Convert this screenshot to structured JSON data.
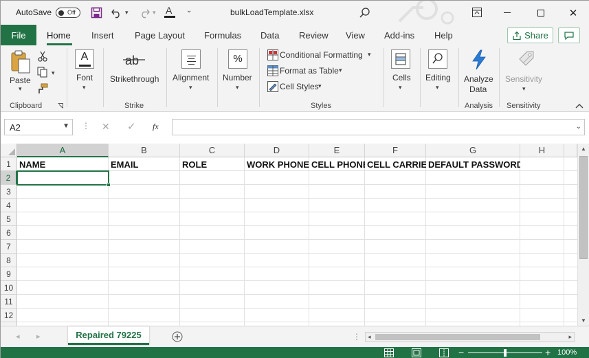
{
  "titlebar": {
    "autosave_label": "AutoSave",
    "autosave_state": "Off",
    "filename": "bulkLoadTemplate.xlsx"
  },
  "menu": {
    "file": "File",
    "tabs": [
      "Home",
      "Insert",
      "Page Layout",
      "Formulas",
      "Data",
      "Review",
      "View",
      "Add-ins",
      "Help"
    ],
    "active_tab": "Home",
    "share": "Share"
  },
  "ribbon": {
    "paste": "Paste",
    "clipboard": "Clipboard",
    "font": "Font",
    "strikethrough": "Strikethrough",
    "strike_group": "Strike",
    "alignment": "Alignment",
    "number": "Number",
    "conditional_formatting": "Conditional Formatting",
    "format_as_table": "Format as Table",
    "cell_styles": "Cell Styles",
    "styles_group": "Styles",
    "cells": "Cells",
    "editing": "Editing",
    "analyze_data_line1": "Analyze",
    "analyze_data_line2": "Data",
    "analysis_group": "Analysis",
    "sensitivity": "Sensitivity",
    "sensitivity_group": "Sensitivity"
  },
  "formula_bar": {
    "name_box": "A2",
    "fx": "fx",
    "value": ""
  },
  "grid": {
    "columns": [
      "A",
      "B",
      "C",
      "D",
      "E",
      "F",
      "G",
      "H"
    ],
    "rows": [
      "1",
      "2",
      "3",
      "4",
      "5",
      "6",
      "7",
      "8",
      "9",
      "10",
      "11",
      "12"
    ],
    "header_row": [
      "NAME",
      "EMAIL",
      "ROLE",
      "WORK PHONE",
      "CELL PHONE",
      "CELL CARRIER",
      "DEFAULT PASSWORD",
      ""
    ],
    "active_cell": "A2"
  },
  "sheets": {
    "active": "Repaired 79225"
  },
  "status": {
    "zoom": "100%"
  },
  "colors": {
    "accent": "#217346"
  }
}
